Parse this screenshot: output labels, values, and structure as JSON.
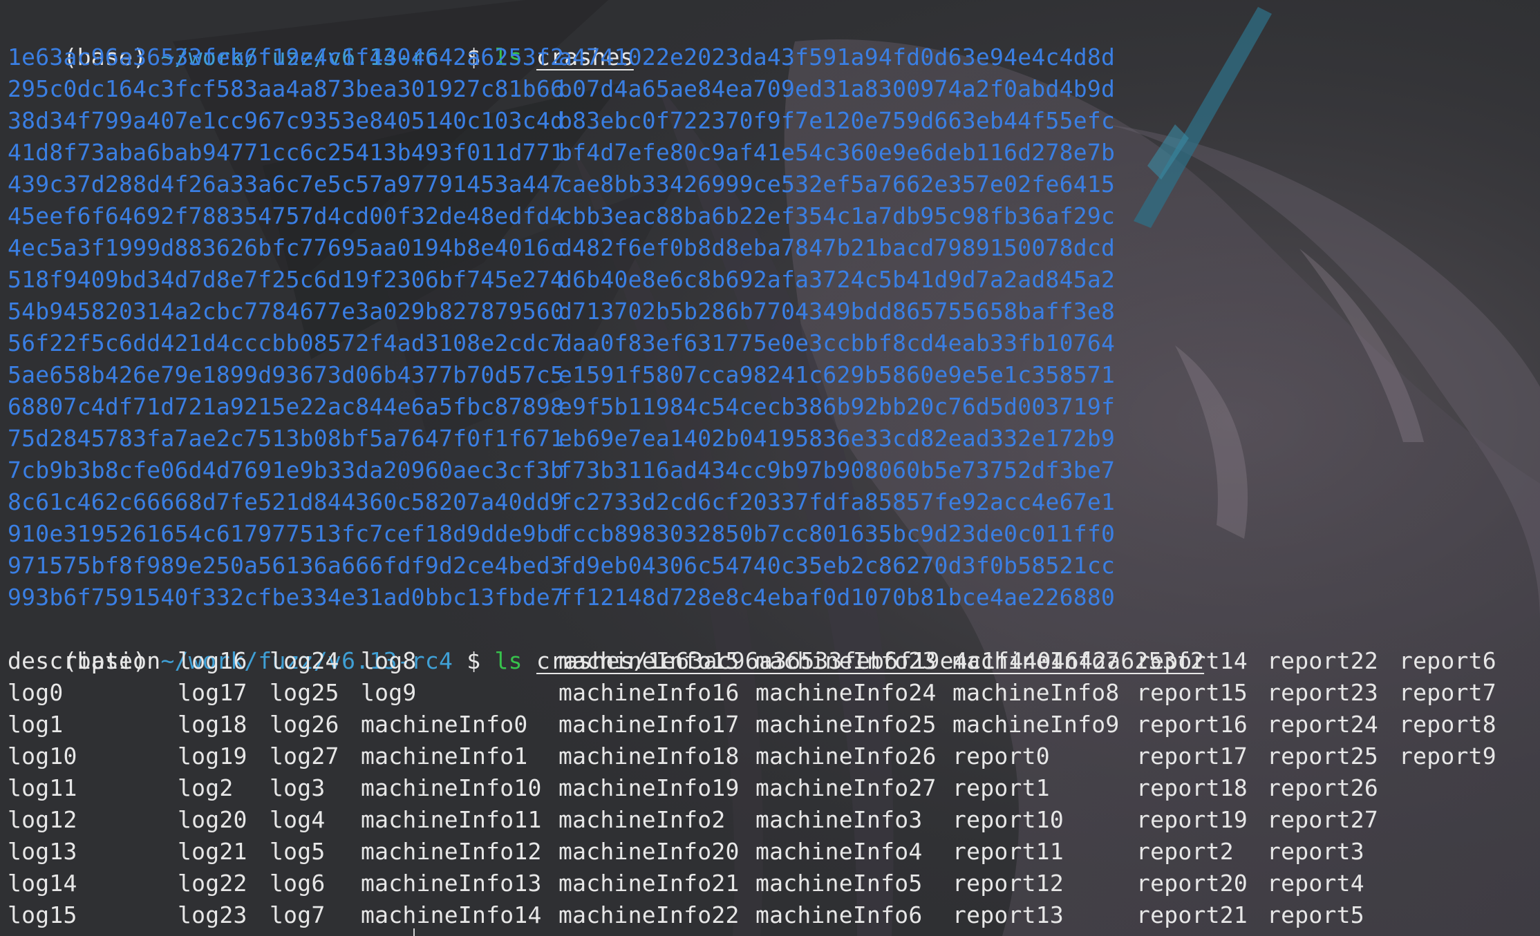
{
  "prompt1": {
    "env": "(base)",
    "path": "~/work/fuzz/v6.13-rc4",
    "dollar": "$",
    "cmd": "ls",
    "arg": "crashes"
  },
  "hashes_left": [
    "1e63ac96a36533feb6f19e4c1f4404642a6253f2",
    "295c0dc164c3fcf583aa4a873bea301927c81b66",
    "38d34f799a407e1cc967c9353e8405140c103c4d",
    "41d8f73aba6bab94771cc6c25413b493f011d771",
    "439c37d288d4f26a33a6c7e5c57a97791453a447",
    "45eef6f64692f788354757d4cd00f32de48edfd4",
    "4ec5a3f1999d883626bfc77695aa0194b8e4016c",
    "518f9409bd34d7d8e7f25c6d19f2306bf745e274",
    "54b945820314a2cbc7784677e3a029b827879560",
    "56f22f5c6dd421d4cccbb08572f4ad3108e2cdc7",
    "5ae658b426e79e1899d93673d06b4377b70d57c5",
    "68807c4df71d721a9215e22ac844e6a5fbc87898",
    "75d2845783fa7ae2c7513b08bf5a7647f0f1f671",
    "7cb9b3b8cfe06d4d7691e9b33da20960aec3cf3b",
    "8c61c462c66668d7fe521d844360c58207a40dd9",
    "910e3195261654c617977513fc7cef18d9dde9bd",
    "971575bf8f989e250a56136a666fdf9d2ce4bed3",
    "993b6f7591540f332cfbe334e31ad0bbc13fbde7"
  ],
  "hashes_right": [
    "a4741022e2023da43f591a94fd0d63e94e4c4d8d",
    "b07d4a65ae84ea709ed31a8300974a2f0abd4b9d",
    "b83ebc0f722370f9f7e120e759d663eb44f55efc",
    "bf4d7efe80c9af41e54c360e9e6deb116d278e7b",
    "cae8bb33426999ce532ef5a7662e357e02fe6415",
    "cbb3eac88ba6b22ef354c1a7db95c98fb36af29c",
    "d482f6ef0b8d8eba7847b21bacd7989150078dcd",
    "d6b40e8e6c8b692afa3724c5b41d9d7a2ad845a2",
    "d713702b5b286b7704349bdd865755658baff3e8",
    "daa0f83ef631775e0e3ccbbf8cd4eab33fb10764",
    "e1591f5807cca98241c629b5860e9e5e1c358571",
    "e9f5b11984c54cecb386b92bb20c76d5d003719f",
    "eb69e7ea1402b04195836e33cd82ead332e172b9",
    "f73b3116ad434cc9b97b908060b5e73752df3be7",
    "fc2733d2cd6cf20337fdfa85857fe92acc4e67e1",
    "fccb8983032850b7cc801635bc9d23de0c011ff0",
    "fd9eb04306c54740c35eb2c86270d3f0b58521cc",
    "ff12148d728e8c4ebaf0d1070b81bce4ae226880"
  ],
  "prompt2": {
    "env": "(base)",
    "path": "~/work/fuzz/v6.13-rc4",
    "dollar": "$",
    "cmd": "ls",
    "arg": "crashes/1e63ac96a36533feb6f19e4c1f4404642a6253f2"
  },
  "file_columns": [
    [
      "description",
      "log0",
      "log1",
      "log10",
      "log11",
      "log12",
      "log13",
      "log14",
      "log15"
    ],
    [
      "log16",
      "log17",
      "log18",
      "log19",
      "log2",
      "log20",
      "log21",
      "log22",
      "log23"
    ],
    [
      "log24",
      "log25",
      "log26",
      "log27",
      "log3",
      "log4",
      "log5",
      "log6",
      "log7"
    ],
    [
      "log8",
      "log9",
      "machineInfo0",
      "machineInfo1",
      "machineInfo10",
      "machineInfo11",
      "machineInfo12",
      "machineInfo13",
      "machineInfo14"
    ],
    [
      "machineInfo15",
      "machineInfo16",
      "machineInfo17",
      "machineInfo18",
      "machineInfo19",
      "machineInfo2",
      "machineInfo20",
      "machineInfo21",
      "machineInfo22"
    ],
    [
      "machineInfo23",
      "machineInfo24",
      "machineInfo25",
      "machineInfo26",
      "machineInfo27",
      "machineInfo3",
      "machineInfo4",
      "machineInfo5",
      "machineInfo6"
    ],
    [
      "machineInfo7",
      "machineInfo8",
      "machineInfo9",
      "report0",
      "report1",
      "report10",
      "report11",
      "report12",
      "report13"
    ],
    [
      "report14",
      "report15",
      "report16",
      "report17",
      "report18",
      "report19",
      "report2",
      "report20",
      "report21"
    ],
    [
      "report22",
      "report23",
      "report24",
      "report25",
      "report26",
      "report27",
      "report3",
      "report4",
      "report5"
    ],
    [
      "report6",
      "report7",
      "report8",
      "report9"
    ]
  ],
  "colors": {
    "background": "#2f3033",
    "hash_text": "#3a7fe4",
    "path_text": "#3fa0d6",
    "command_text": "#37c24c",
    "plain_text": "#e7e7e7"
  }
}
